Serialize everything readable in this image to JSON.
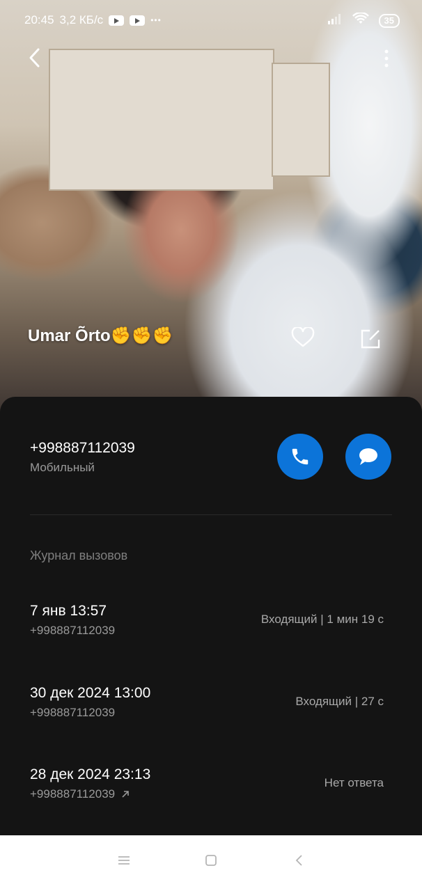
{
  "statusbar": {
    "time": "20:45",
    "speed": "3,2 КБ/с",
    "more": "•••",
    "battery": "35"
  },
  "contact": {
    "name": "Umar Õrto✊✊✊"
  },
  "phone": {
    "number": "+998887112039",
    "type": "Мобильный"
  },
  "call_log": {
    "title": "Журнал вызовов",
    "items": [
      {
        "date": "7 янв 13:57",
        "number": "+998887112039",
        "status": "Входящий | 1 мин 19 с"
      },
      {
        "date": "30 дек 2024 13:00",
        "number": "+998887112039",
        "status": "Входящий | 27 с"
      },
      {
        "date": "28 дек 2024 23:13",
        "number": "+998887112039",
        "status": "Нет ответа"
      }
    ]
  },
  "colors": {
    "accent": "#0c74d9",
    "panel": "#141414"
  }
}
